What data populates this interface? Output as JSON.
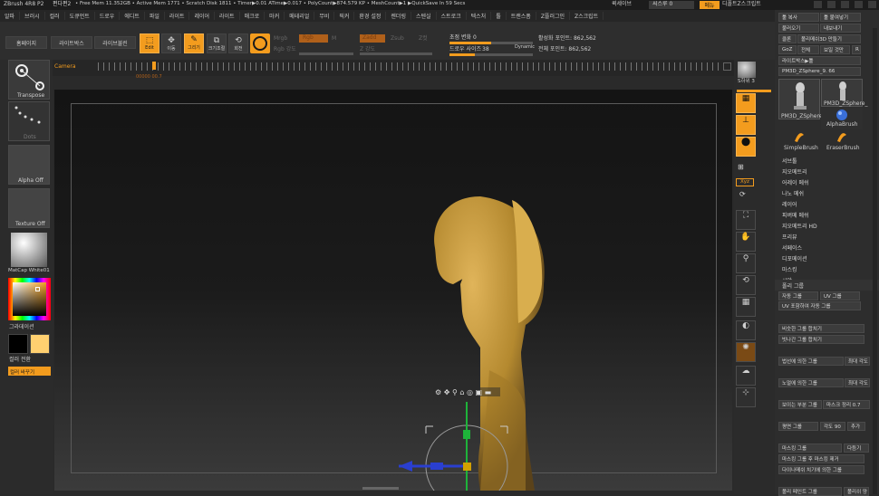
{
  "titlebar": {
    "app": "ZBrush 4R8 P2",
    "doc": "편다편2",
    "stats": "• Free Mem 11.352GB • Active Mem 1771 • Scratch Disk 1811 • Timer▶0.01 ATime▶0.017 • PolyCount▶874.579 KP • MeshCount▶1 ▶QuickSave In 59 Secs",
    "see_through": "씨스루 0",
    "quicksave": "퀵세이브",
    "menu_btn": "메뉴",
    "default_script": "디폴트Z스크립트"
  },
  "menubar": {
    "items": [
      "알파",
      "브러시",
      "컬러",
      "도큐먼트",
      "드로우",
      "에디트",
      "파일",
      "라이트",
      "레이어",
      "라이트",
      "매크로",
      "마커",
      "메테리얼",
      "무비",
      "픽커",
      "환경 설정",
      "렌더링",
      "스텐실",
      "스트로크",
      "텍스처",
      "툴",
      "트랜스폼",
      "Z플러그인",
      "Z스크립트"
    ]
  },
  "toolbar": {
    "home_page": "홈페이지",
    "lightbox": "라이트박스",
    "live_boolean": "라이브불린",
    "edit": "Edit",
    "move": "이동",
    "draw": "그리기",
    "scale": "크기조절",
    "rotate": "회전",
    "mrgb": "Mrgb",
    "rgb": "Rgb",
    "m": "M",
    "zadd": "Zadd",
    "zsub": "Zsub",
    "zcut": "Z컷",
    "rgb_intensity": "Rgb 강도",
    "z_intensity": "Z 강도",
    "focal_shift_label": "초점 변화",
    "focal_shift_value": "0",
    "draw_size_label": "드로우 사이즈",
    "draw_size_value": "38",
    "dynamic": "Dynamic",
    "active_points": "활성화 포인트: 862,562",
    "total_points": "전체 포인트: 862,562",
    "focal_shift_fill": 0.5,
    "draw_size_fill": 0.3
  },
  "timeline": {
    "camera": "Camera",
    "readout": "00000 00.7"
  },
  "leftpanel": {
    "transpose": "Transpose",
    "dots": "Dots",
    "alpha": "Alpha Off",
    "texture": "Texture Off",
    "material": "MatCap White01",
    "gradient": "그라데이션",
    "color_switch": "컬러 전환",
    "color_change": "컬러 바꾸기",
    "main_color": "#ffd070"
  },
  "rightshelf": {
    "sdiv": "S하위 3",
    "labels": [
      "원근",
      "바닥",
      "로컬",
      "Xyz",
      "",
      "",
      "",
      "",
      "",
      "",
      "Line Fill",
      "",
      "",
      "Dynamic",
      ""
    ],
    "xyz": "Xyz"
  },
  "tray": {
    "tool_copy": "툴 복사",
    "tool_paste": "툴 붙여넣기",
    "import": "불러오기",
    "export": "내보내기",
    "clone": "클론",
    "polymesh": "폴리메쉬3D 만들기",
    "goz": "GoZ",
    "all": "전체",
    "visible": "보일 것만",
    "r": "R",
    "lightbox_tools": "라이트박스▶툴",
    "current_tool": "PM3D_ZSphere_9. 66",
    "brushes": [
      "PM3D_ZSphere_",
      "PM3D_ZSphere_",
      "SimpleBrush",
      "EraserBrush"
    ],
    "alpha_brush": "AlphaBrush",
    "menu_items": [
      "서브툴",
      "지오메트리",
      "어레이 메쉬",
      "나노 메쉬",
      "레이어",
      "피버메 메쉬",
      "지오메트리 HD",
      "프리뷰",
      "서페이스",
      "디포메이션",
      "마스킹",
      "시야"
    ],
    "polygroups": "폴리 그룹",
    "auto_group": "자동 그룹",
    "uv_group": "UV 그룹",
    "uv_auto": "UV 포함하여 자동 그룹",
    "merge_similar": "비슷한 그룹 합치기",
    "merge_stray": "빗나간 그룹 합치기",
    "group_by_normals": "법선에 의한 그룹",
    "max_tolerance": "최대 각도",
    "group_by_normal_2": "노멀에 의한 그룹",
    "max_angle": "최대 각도",
    "group_visible": "보이는 부분 그룹",
    "weld": "마스크 정리 0.7",
    "plane_group": "평면 그룹",
    "angle_90": "각도 90",
    "add": "추가",
    "masking_group": "마스킹 그룹",
    "clear": "다듬기",
    "mask_group_remove": "마스킹 그룹 후 마스킹 제거",
    "dynamesh_group": "다이나메쉬 치기에 의한 그룹",
    "polypaint_group": "폴리 페인트 그룹",
    "polish": "폴리쉬 양"
  },
  "colors": {
    "accent": "#f39c1e",
    "skin": "#c49a3a",
    "bg": "#2b2b2b"
  }
}
